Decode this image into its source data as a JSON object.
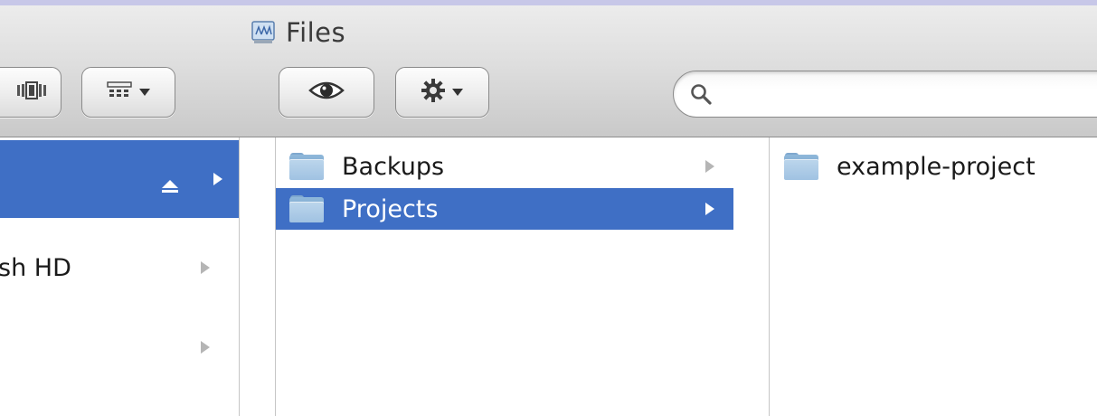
{
  "window": {
    "title": "Files",
    "title_icon": "network-volume-icon"
  },
  "toolbar": {
    "coverflow_icon": "coverflow-view-icon",
    "arrange_icon": "arrange-grid-icon",
    "quicklook_icon": "eye-icon",
    "action_icon": "gear-icon",
    "search": {
      "value": "",
      "placeholder": "",
      "icon": "search-icon"
    }
  },
  "columns": {
    "sidebar": {
      "items": [
        {
          "label": "",
          "selected": true,
          "eject_icon": "eject-icon",
          "has_arrow": true
        },
        {
          "label": "sh HD",
          "selected": false,
          "has_arrow": true
        },
        {
          "label": "",
          "selected": false,
          "has_arrow": true
        }
      ]
    },
    "col2": {
      "items": [
        {
          "label": "Backups",
          "selected": false,
          "icon": "folder-icon"
        },
        {
          "label": "Projects",
          "selected": true,
          "icon": "folder-icon"
        }
      ]
    },
    "col3": {
      "items": [
        {
          "label": "example-project",
          "selected": false,
          "icon": "folder-icon"
        }
      ]
    }
  },
  "colors": {
    "selection": "#3f6fc5",
    "background": "#c7c7e8"
  }
}
